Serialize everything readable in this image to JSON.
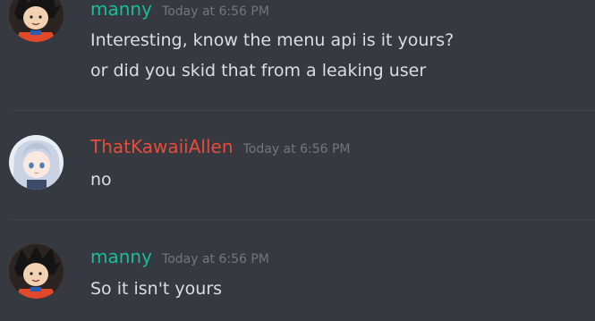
{
  "colors": {
    "background": "#36393f",
    "username_manny": "#1abc9c",
    "username_allen": "#e74c3c",
    "message_text": "#dcddde",
    "timestamp": "#72767d",
    "divider": "#40444b"
  },
  "messages": [
    {
      "author": "manny",
      "timestamp": "Today at 6:56 PM",
      "avatar_icon": "goku-avatar-icon",
      "lines": [
        "Interesting, know the menu api is it yours?",
        "or did you skid that from a leaking user"
      ]
    },
    {
      "author": "ThatKawaiiAllen",
      "timestamp": "Today at 6:56 PM",
      "avatar_icon": "anime-girl-avatar-icon",
      "lines": [
        "no"
      ]
    },
    {
      "author": "manny",
      "timestamp": "Today at 6:56 PM",
      "avatar_icon": "goku-avatar-icon",
      "lines": [
        "So it isn't yours"
      ]
    }
  ]
}
